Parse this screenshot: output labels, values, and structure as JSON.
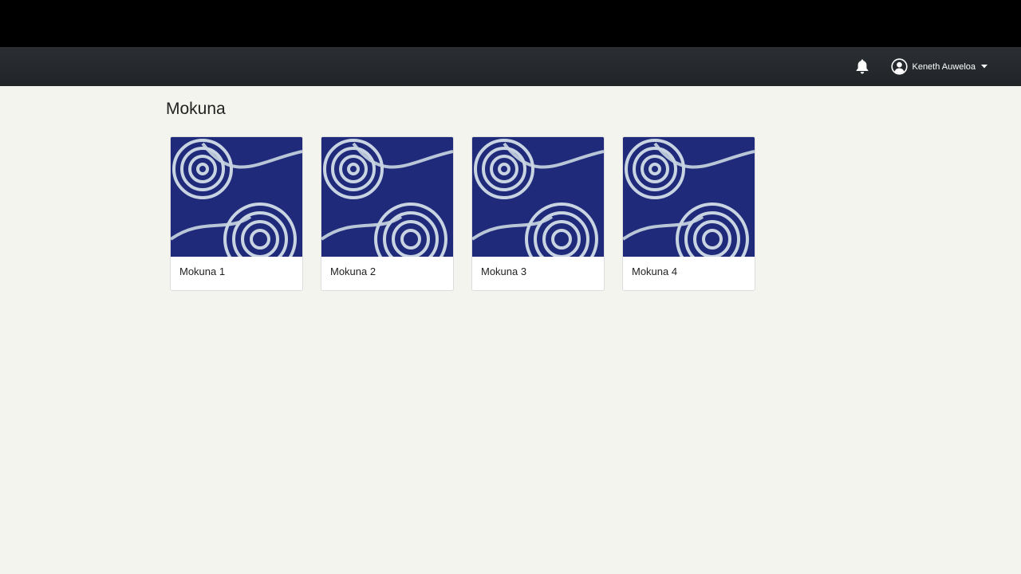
{
  "navbar": {
    "bell_icon": "bell-icon",
    "user": {
      "name": "Keneth Auweloa",
      "avatar_icon": "user-circle-icon",
      "caret_icon": "caret-down-icon"
    }
  },
  "page": {
    "title": "Mokuna"
  },
  "cards": [
    {
      "label": "Mokuna 1"
    },
    {
      "label": "Mokuna 2"
    },
    {
      "label": "Mokuna 3"
    },
    {
      "label": "Mokuna 4"
    }
  ],
  "colors": {
    "navbar": "#24282c",
    "thumb_background": "#1f2a7a",
    "page_background": "#f3f4ee"
  }
}
